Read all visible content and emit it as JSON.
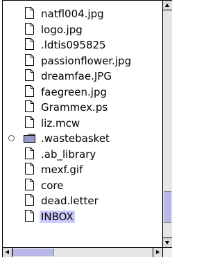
{
  "file_list": {
    "items": [
      {
        "label": "natfl004.jpg",
        "icon": "document-icon"
      },
      {
        "label": "logo.jpg",
        "icon": "document-icon"
      },
      {
        "label": ".ldtis095825",
        "icon": "document-icon"
      },
      {
        "label": "passionflower.jpg",
        "icon": "document-icon"
      },
      {
        "label": "dreamfae.JPG",
        "icon": "document-icon"
      },
      {
        "label": "faegreen.jpg",
        "icon": "document-icon"
      },
      {
        "label": "Grammex.ps",
        "icon": "document-icon"
      },
      {
        "label": "liz.mcw",
        "icon": "document-icon"
      },
      {
        "label": ".wastebasket",
        "icon": "folder-icon",
        "expander": "radio-icon"
      },
      {
        "label": ".ab_library",
        "icon": "document-icon"
      },
      {
        "label": "mexf.gif",
        "icon": "document-icon"
      },
      {
        "label": "core",
        "icon": "document-icon"
      },
      {
        "label": "dead.letter",
        "icon": "document-icon"
      },
      {
        "label": "INBOX",
        "icon": "document-icon",
        "selected": true
      }
    ]
  },
  "scrollbars": {
    "vertical_position": 0.92,
    "horizontal_position": 0.0
  },
  "colors": {
    "selection": "#ccccff",
    "scroll_thumb": "#b8b8e8",
    "track": "#e6e6e6"
  }
}
